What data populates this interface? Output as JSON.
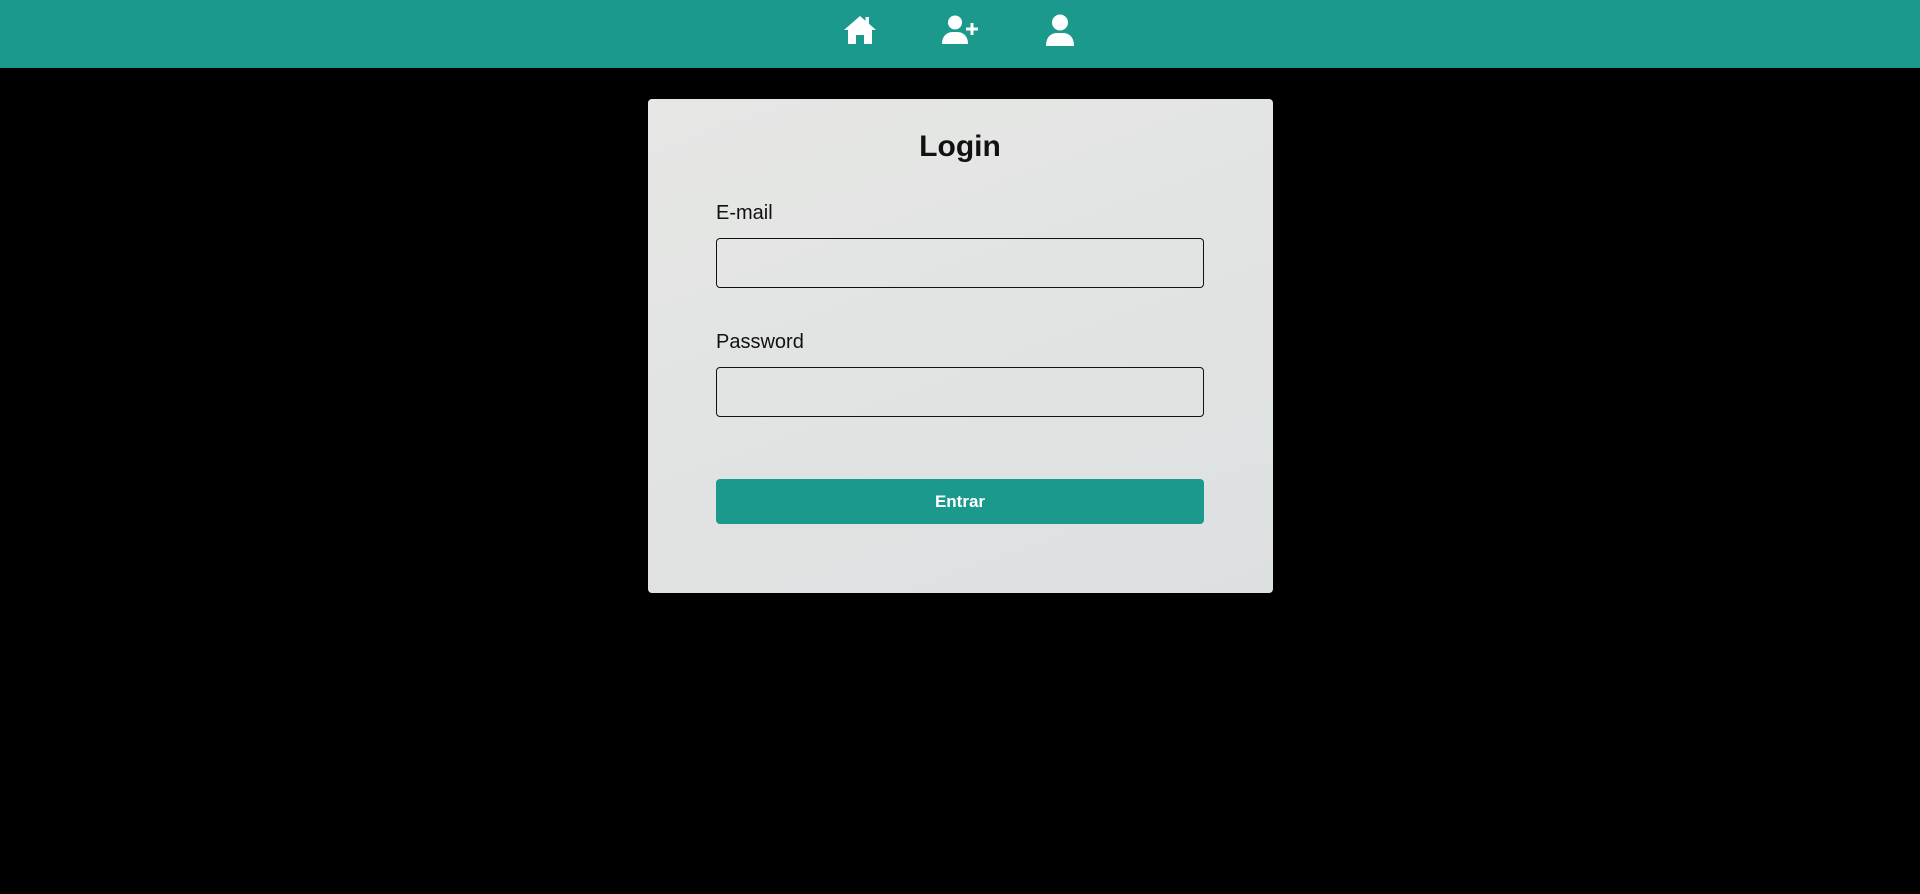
{
  "navbar": {
    "background": "#1a998c",
    "icons": [
      {
        "name": "home-icon"
      },
      {
        "name": "user-plus-icon"
      },
      {
        "name": "user-icon"
      }
    ]
  },
  "login": {
    "title": "Login",
    "email_label": "E-mail",
    "email_value": "",
    "email_placeholder": "",
    "password_label": "Password",
    "password_value": "",
    "password_placeholder": "",
    "submit_label": "Entrar"
  },
  "colors": {
    "accent": "#1a998c",
    "page_background": "#000000",
    "card_background": "#e2e4e3"
  }
}
